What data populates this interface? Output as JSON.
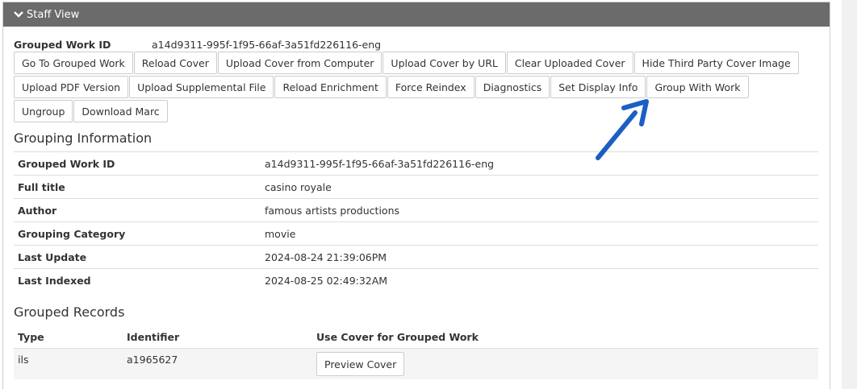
{
  "panel": {
    "title": "Staff View"
  },
  "grouped_work_id": {
    "label": "Grouped Work ID",
    "value": "a14d9311-995f-1f95-66af-3a51fd226116-eng"
  },
  "buttons": [
    "Go To Grouped Work",
    "Reload Cover",
    "Upload Cover from Computer",
    "Upload Cover by URL",
    "Clear Uploaded Cover",
    "Hide Third Party Cover Image",
    "Upload PDF Version",
    "Upload Supplemental File",
    "Reload Enrichment",
    "Force Reindex",
    "Diagnostics",
    "Set Display Info",
    "Group With Work",
    "Ungroup",
    "Download Marc"
  ],
  "grouping": {
    "heading": "Grouping Information",
    "rows": [
      {
        "k": "Grouped Work ID",
        "v": "a14d9311-995f-1f95-66af-3a51fd226116-eng"
      },
      {
        "k": "Full title",
        "v": "casino royale"
      },
      {
        "k": "Author",
        "v": "famous artists productions"
      },
      {
        "k": "Grouping Category",
        "v": "movie"
      },
      {
        "k": "Last Update",
        "v": "2024-08-24 21:39:06PM"
      },
      {
        "k": "Last Indexed",
        "v": "2024-08-25 02:49:32AM"
      }
    ]
  },
  "records": {
    "heading": "Grouped Records",
    "columns": [
      "Type",
      "Identifier",
      "Use Cover for Grouped Work"
    ],
    "rows": [
      {
        "type": "ils",
        "identifier": "a1965627",
        "button": "Preview Cover"
      }
    ]
  },
  "colors": {
    "header": "#6b6b6b",
    "arrow": "#1a5fc4"
  }
}
